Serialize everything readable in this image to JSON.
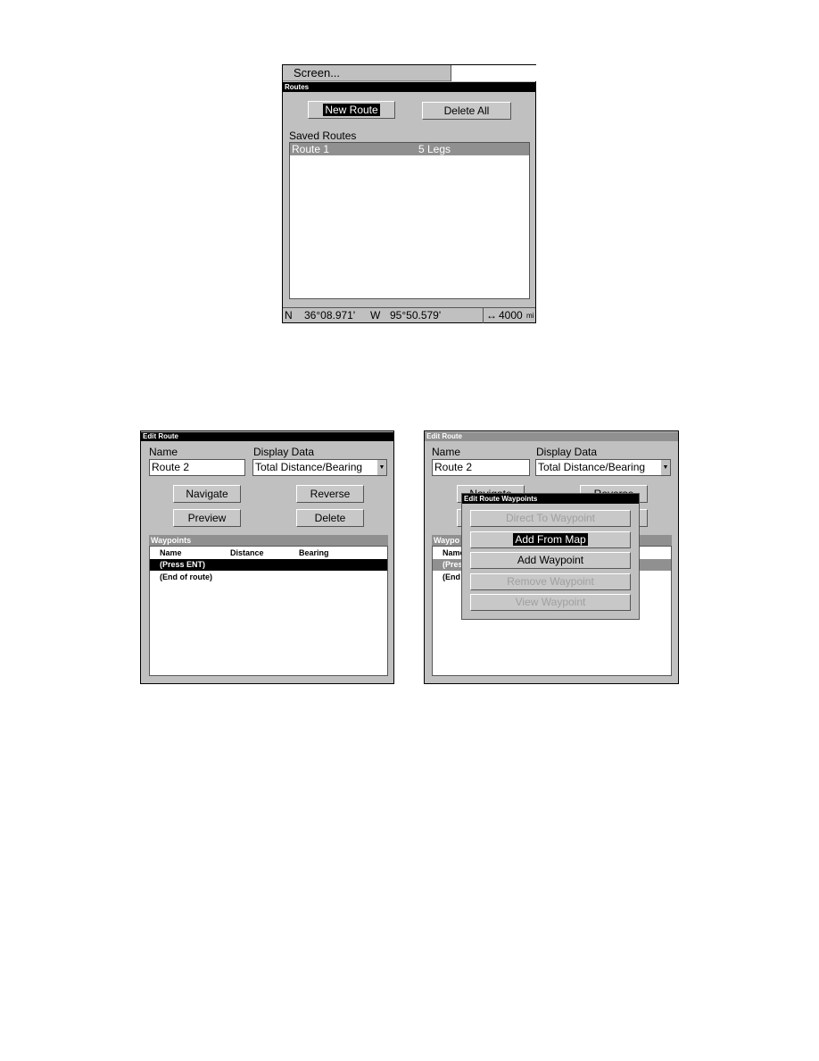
{
  "routes_screen": {
    "menu_label": "Screen...",
    "title": "Routes",
    "buttons": {
      "new_route": "New Route",
      "delete_all": "Delete All"
    },
    "saved_routes_label": "Saved Routes",
    "routes": [
      {
        "name": "Route 1",
        "legs": "5 Legs"
      }
    ],
    "status": {
      "lat_hemi": "N",
      "lat": "36°08.971'",
      "lon_hemi": "W",
      "lon": "95°50.579'",
      "zoom_icon": "double-arrow-icon",
      "zoom": "4000",
      "zoom_unit": "mi"
    }
  },
  "edit_route": {
    "title": "Edit Route",
    "name_label": "Name",
    "name_value": "Route 2",
    "display_label": "Display Data",
    "display_value": "Total Distance/Bearing",
    "buttons": {
      "navigate": "Navigate",
      "reverse": "Reverse",
      "preview": "Preview",
      "delete": "Delete"
    },
    "waypoints_label": "Waypoints",
    "columns": [
      "Name",
      "Distance",
      "Bearing"
    ],
    "rows": [
      "(Press ENT)",
      "(End of route)"
    ]
  },
  "edit_route_popup": {
    "background_labels": {
      "waypoints": "Waypo",
      "name": "Name",
      "row1": "(Pres",
      "row2": "(End",
      "navigate": "Navigate",
      "reverse": "Reverse"
    },
    "title": "Edit Route Waypoints",
    "items": [
      {
        "label": "Direct To Waypoint",
        "enabled": false
      },
      {
        "label": "Add From Map",
        "enabled": true,
        "selected": true
      },
      {
        "label": "Add Waypoint",
        "enabled": true
      },
      {
        "label": "Remove Waypoint",
        "enabled": false
      },
      {
        "label": "View Waypoint",
        "enabled": false
      }
    ]
  }
}
